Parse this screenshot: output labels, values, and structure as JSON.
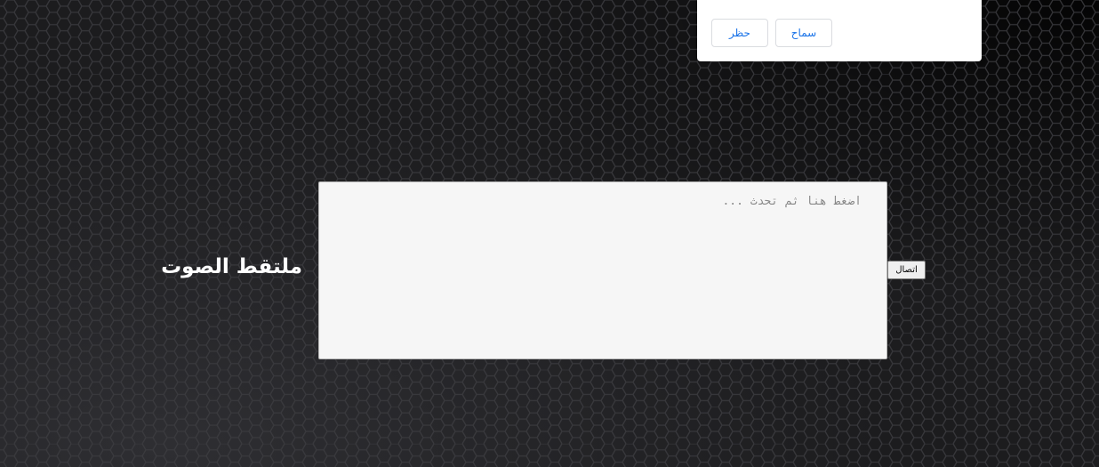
{
  "page": {
    "title": "ملتقط الصوت"
  },
  "speech_input": {
    "placeholder": "اضغط هنا ثم تحدث ...",
    "value": ""
  },
  "connect_button": {
    "label": "اتصال"
  },
  "permission_popup": {
    "message": "",
    "allow_label": "سماح",
    "block_label": "حظر"
  },
  "colors": {
    "background": "#1c1c1e",
    "hex_lines": "#3a3a3e",
    "popup_button_text": "#1a73e8",
    "textarea_bg": "#f6f6f6"
  }
}
